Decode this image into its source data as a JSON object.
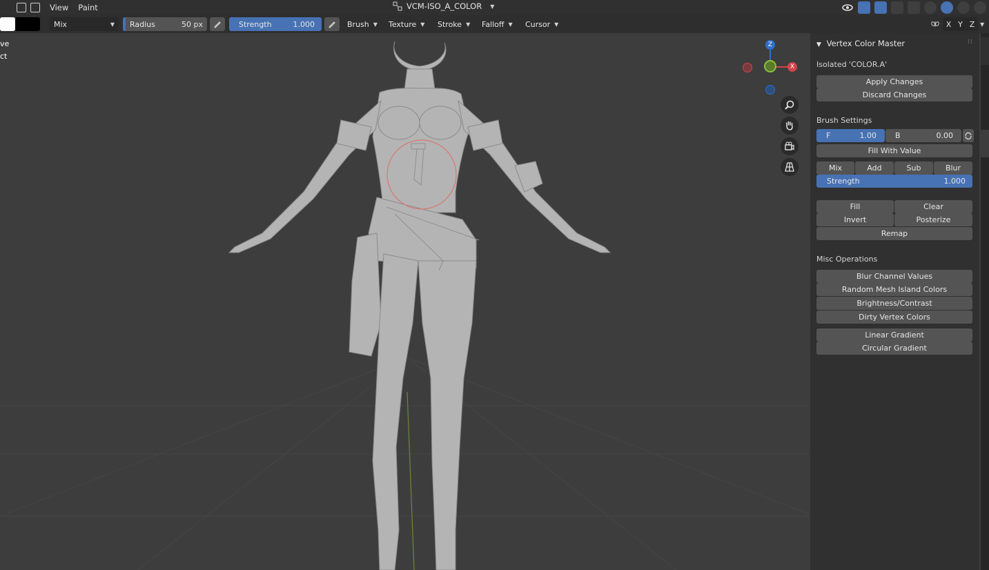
{
  "header": {
    "menus": [
      "View",
      "Paint"
    ],
    "title": "VCM-ISO_A_COLOR"
  },
  "toolbar": {
    "blend_mode": "Mix",
    "radius_label": "Radius",
    "radius_value": "50 px",
    "strength_label": "Strength",
    "strength_value": "1.000",
    "menus": [
      "Brush",
      "Texture",
      "Stroke",
      "Falloff",
      "Cursor"
    ],
    "axes": [
      "X",
      "Y",
      "Z"
    ]
  },
  "viewport": {
    "overlay_lines": [
      "ve",
      "ct"
    ]
  },
  "gizmo": {
    "z": "Z",
    "x": "X"
  },
  "panel": {
    "title": "Vertex Color Master",
    "isolated": "Isolated 'COLOR.A'",
    "apply": "Apply Changes",
    "discard": "Discard Changes",
    "brush_settings": "Brush Settings",
    "f_label": "F",
    "f_value": "1.00",
    "b_label": "B",
    "b_value": "0.00",
    "fill_with_value": "Fill With Value",
    "modes": [
      "Mix",
      "Add",
      "Sub",
      "Blur"
    ],
    "strength_label": "Strength",
    "strength_value": "1.000",
    "fill": "Fill",
    "clear": "Clear",
    "invert": "Invert",
    "posterize": "Posterize",
    "remap": "Remap",
    "misc": "Misc Operations",
    "misc_ops": [
      "Blur Channel Values",
      "Random Mesh Island Colors",
      "Brightness/Contrast",
      "Dirty Vertex Colors"
    ],
    "gradients": [
      "Linear Gradient",
      "Circular Gradient"
    ]
  },
  "colors": {
    "accent": "#4772b3",
    "panel": "#303030",
    "viewport": "#3d3d3d"
  }
}
